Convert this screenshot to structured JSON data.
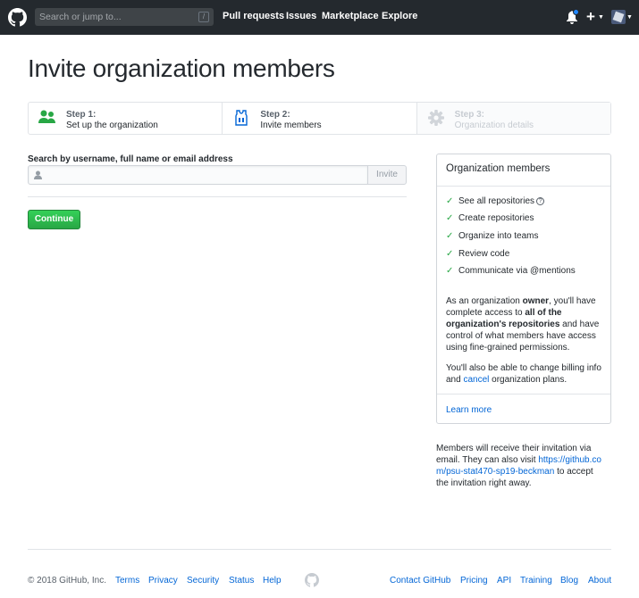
{
  "header": {
    "search_placeholder": "Search or jump to...",
    "search_shortcut": "/",
    "nav": [
      "Pull requests",
      "Issues",
      "Marketplace",
      "Explore"
    ],
    "plus_label": "+"
  },
  "page_title": "Invite organization members",
  "steps": [
    {
      "num": "Step 1:",
      "label": "Set up the organization",
      "icon": "people-icon"
    },
    {
      "num": "Step 2:",
      "label": "Invite members",
      "icon": "jersey-icon"
    },
    {
      "num": "Step 3:",
      "label": "Organization details",
      "icon": "gear-icon"
    }
  ],
  "form": {
    "search_label": "Search by username, full name or email address",
    "invite_button": "Invite",
    "continue_button": "Continue"
  },
  "sidebar": {
    "title": "Organization members",
    "features": [
      "See all repositories",
      "Create repositories",
      "Organize into teams",
      "Review code",
      "Communicate via @mentions"
    ],
    "para1": {
      "t1": "As an organization ",
      "b1": "owner",
      "t2": ", you'll have complete access to ",
      "b2": "all of the organization's repositories",
      "t3": " and have control of what members have access using fine-grained permissions."
    },
    "para2": {
      "t1": "You'll also be able to change billing info and ",
      "link": "cancel",
      "t2": " organization plans."
    },
    "learn_more": "Learn more"
  },
  "note": {
    "t1": "Members will receive their invitation via email. They can also visit ",
    "link": "https://github.com/psu-stat470-sp19-beckman",
    "t2": " to accept the invitation right away."
  },
  "footer": {
    "copyright": "© 2018 GitHub, Inc.",
    "left_links": [
      "Terms",
      "Privacy",
      "Security",
      "Status",
      "Help"
    ],
    "right_links": [
      "Contact GitHub",
      "Pricing",
      "API",
      "Training",
      "Blog",
      "About"
    ]
  },
  "colors": {
    "header_bg": "#24292e",
    "link": "#0366d6",
    "success": "#28a745",
    "notification": "#2188ff"
  }
}
